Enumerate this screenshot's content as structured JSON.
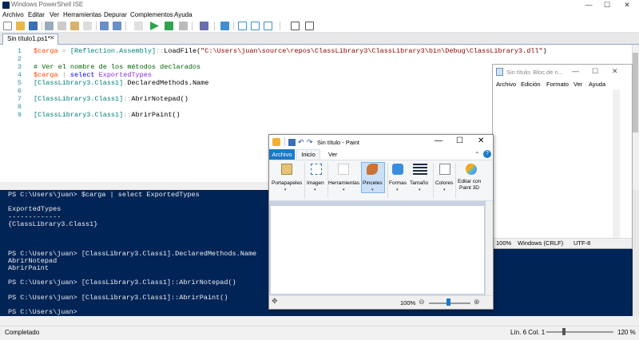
{
  "ise": {
    "title": "Windows PowerShell ISE",
    "window_buttons": [
      "—",
      "☐",
      "✕"
    ],
    "menu": [
      "Archivo",
      "Editar",
      "Ver",
      "Herramientas",
      "Depurar",
      "Complementos",
      "Ayuda"
    ],
    "tab_label": "Sin título1.ps1*",
    "tab_close": "✕",
    "code": [
      {
        "ln": "1",
        "parts": [
          [
            "var",
            "$carga"
          ],
          [
            "op",
            " = "
          ],
          [
            "type",
            "[Reflection.Assembly]"
          ],
          [
            "op",
            "::"
          ],
          [
            "member",
            "LoadFile"
          ],
          [
            "member",
            "("
          ],
          [
            "str",
            "\"C:\\Users\\juan\\source\\repos\\ClassLibrary3\\ClassLibrary3\\bin\\Debug\\ClassLibrary3.dll\""
          ],
          [
            "member",
            ")"
          ]
        ]
      },
      {
        "ln": "2",
        "parts": []
      },
      {
        "ln": "3",
        "parts": [
          [
            "cmt",
            "# Ver el nombre de los métodos declarados"
          ]
        ]
      },
      {
        "ln": "4",
        "parts": [
          [
            "var",
            "$carga"
          ],
          [
            "op",
            " | "
          ],
          [
            "cmd",
            "select"
          ],
          [
            "prop",
            " ExportedTypes"
          ]
        ]
      },
      {
        "ln": "5",
        "parts": [
          [
            "type",
            "[ClassLibrary3.Class1]"
          ],
          [
            "op",
            "."
          ],
          [
            "member",
            "DeclaredMethods.Name"
          ]
        ]
      },
      {
        "ln": "6",
        "parts": []
      },
      {
        "ln": "7",
        "parts": [
          [
            "type",
            "[ClassLibrary3.Class1]"
          ],
          [
            "op",
            "::"
          ],
          [
            "member",
            "AbrirNotepad()"
          ]
        ]
      },
      {
        "ln": "8",
        "parts": []
      },
      {
        "ln": "9",
        "parts": [
          [
            "type",
            "[ClassLibrary3.Class1]"
          ],
          [
            "op",
            "::"
          ],
          [
            "member",
            "AbrirPaint()"
          ]
        ]
      }
    ],
    "console": [
      "PS C:\\Users\\juan> $carga | select ExportedTypes",
      "",
      "ExportedTypes",
      "-------------",
      "{ClassLibrary3.Class1}",
      "",
      "",
      "",
      "PS C:\\Users\\juan> [ClassLibrary3.Class1].DeclaredMethods.Name",
      "AbrirNotepad",
      "AbrirPaint",
      "",
      "PS C:\\Users\\juan> [ClassLibrary3.Class1]::AbrirNotepad()",
      "",
      "PS C:\\Users\\juan> [ClassLibrary3.Class1]::AbrirPaint()",
      "",
      "PS C:\\Users\\juan>"
    ],
    "status": "Completado",
    "position": "Lín. 6  Col. 1",
    "zoom": "120 %"
  },
  "notepad": {
    "title": "Sin título: Bloc de n...",
    "window_buttons": [
      "—",
      "☐",
      "✕"
    ],
    "menu": [
      "Archivo",
      "Edición",
      "Formato",
      "Ver",
      "Ayuda"
    ],
    "status": [
      "100%",
      "Windows (CRLF)",
      "UTF-8"
    ]
  },
  "paint": {
    "title": "Sin título - Paint",
    "window_buttons": [
      "—",
      "☐",
      "✕"
    ],
    "tabs": [
      "Archivo",
      "Inicio",
      "Ver"
    ],
    "ribbon": [
      {
        "label": "Portapapeles",
        "arrow": "▾"
      },
      {
        "label": "Imagen",
        "arrow": "▾"
      },
      {
        "label": "Herramientas",
        "arrow": "▾"
      },
      {
        "label": "Pinceles",
        "arrow": "▾"
      },
      {
        "label": "Formas",
        "arrow": "▾"
      },
      {
        "label": "Tamaño",
        "arrow": "▾"
      },
      {
        "label": "Colores",
        "arrow": "▾"
      },
      {
        "label": "Editar con",
        "label2": "Paint 3D"
      }
    ],
    "zoom": "100%",
    "help": "?",
    "chevron": "⌃",
    "zoom_minus": "⊖",
    "zoom_plus": "⊕",
    "move_icon": "✥"
  },
  "colors": {
    "console_bg": "#012456",
    "paint_accent": "#1979ca"
  }
}
